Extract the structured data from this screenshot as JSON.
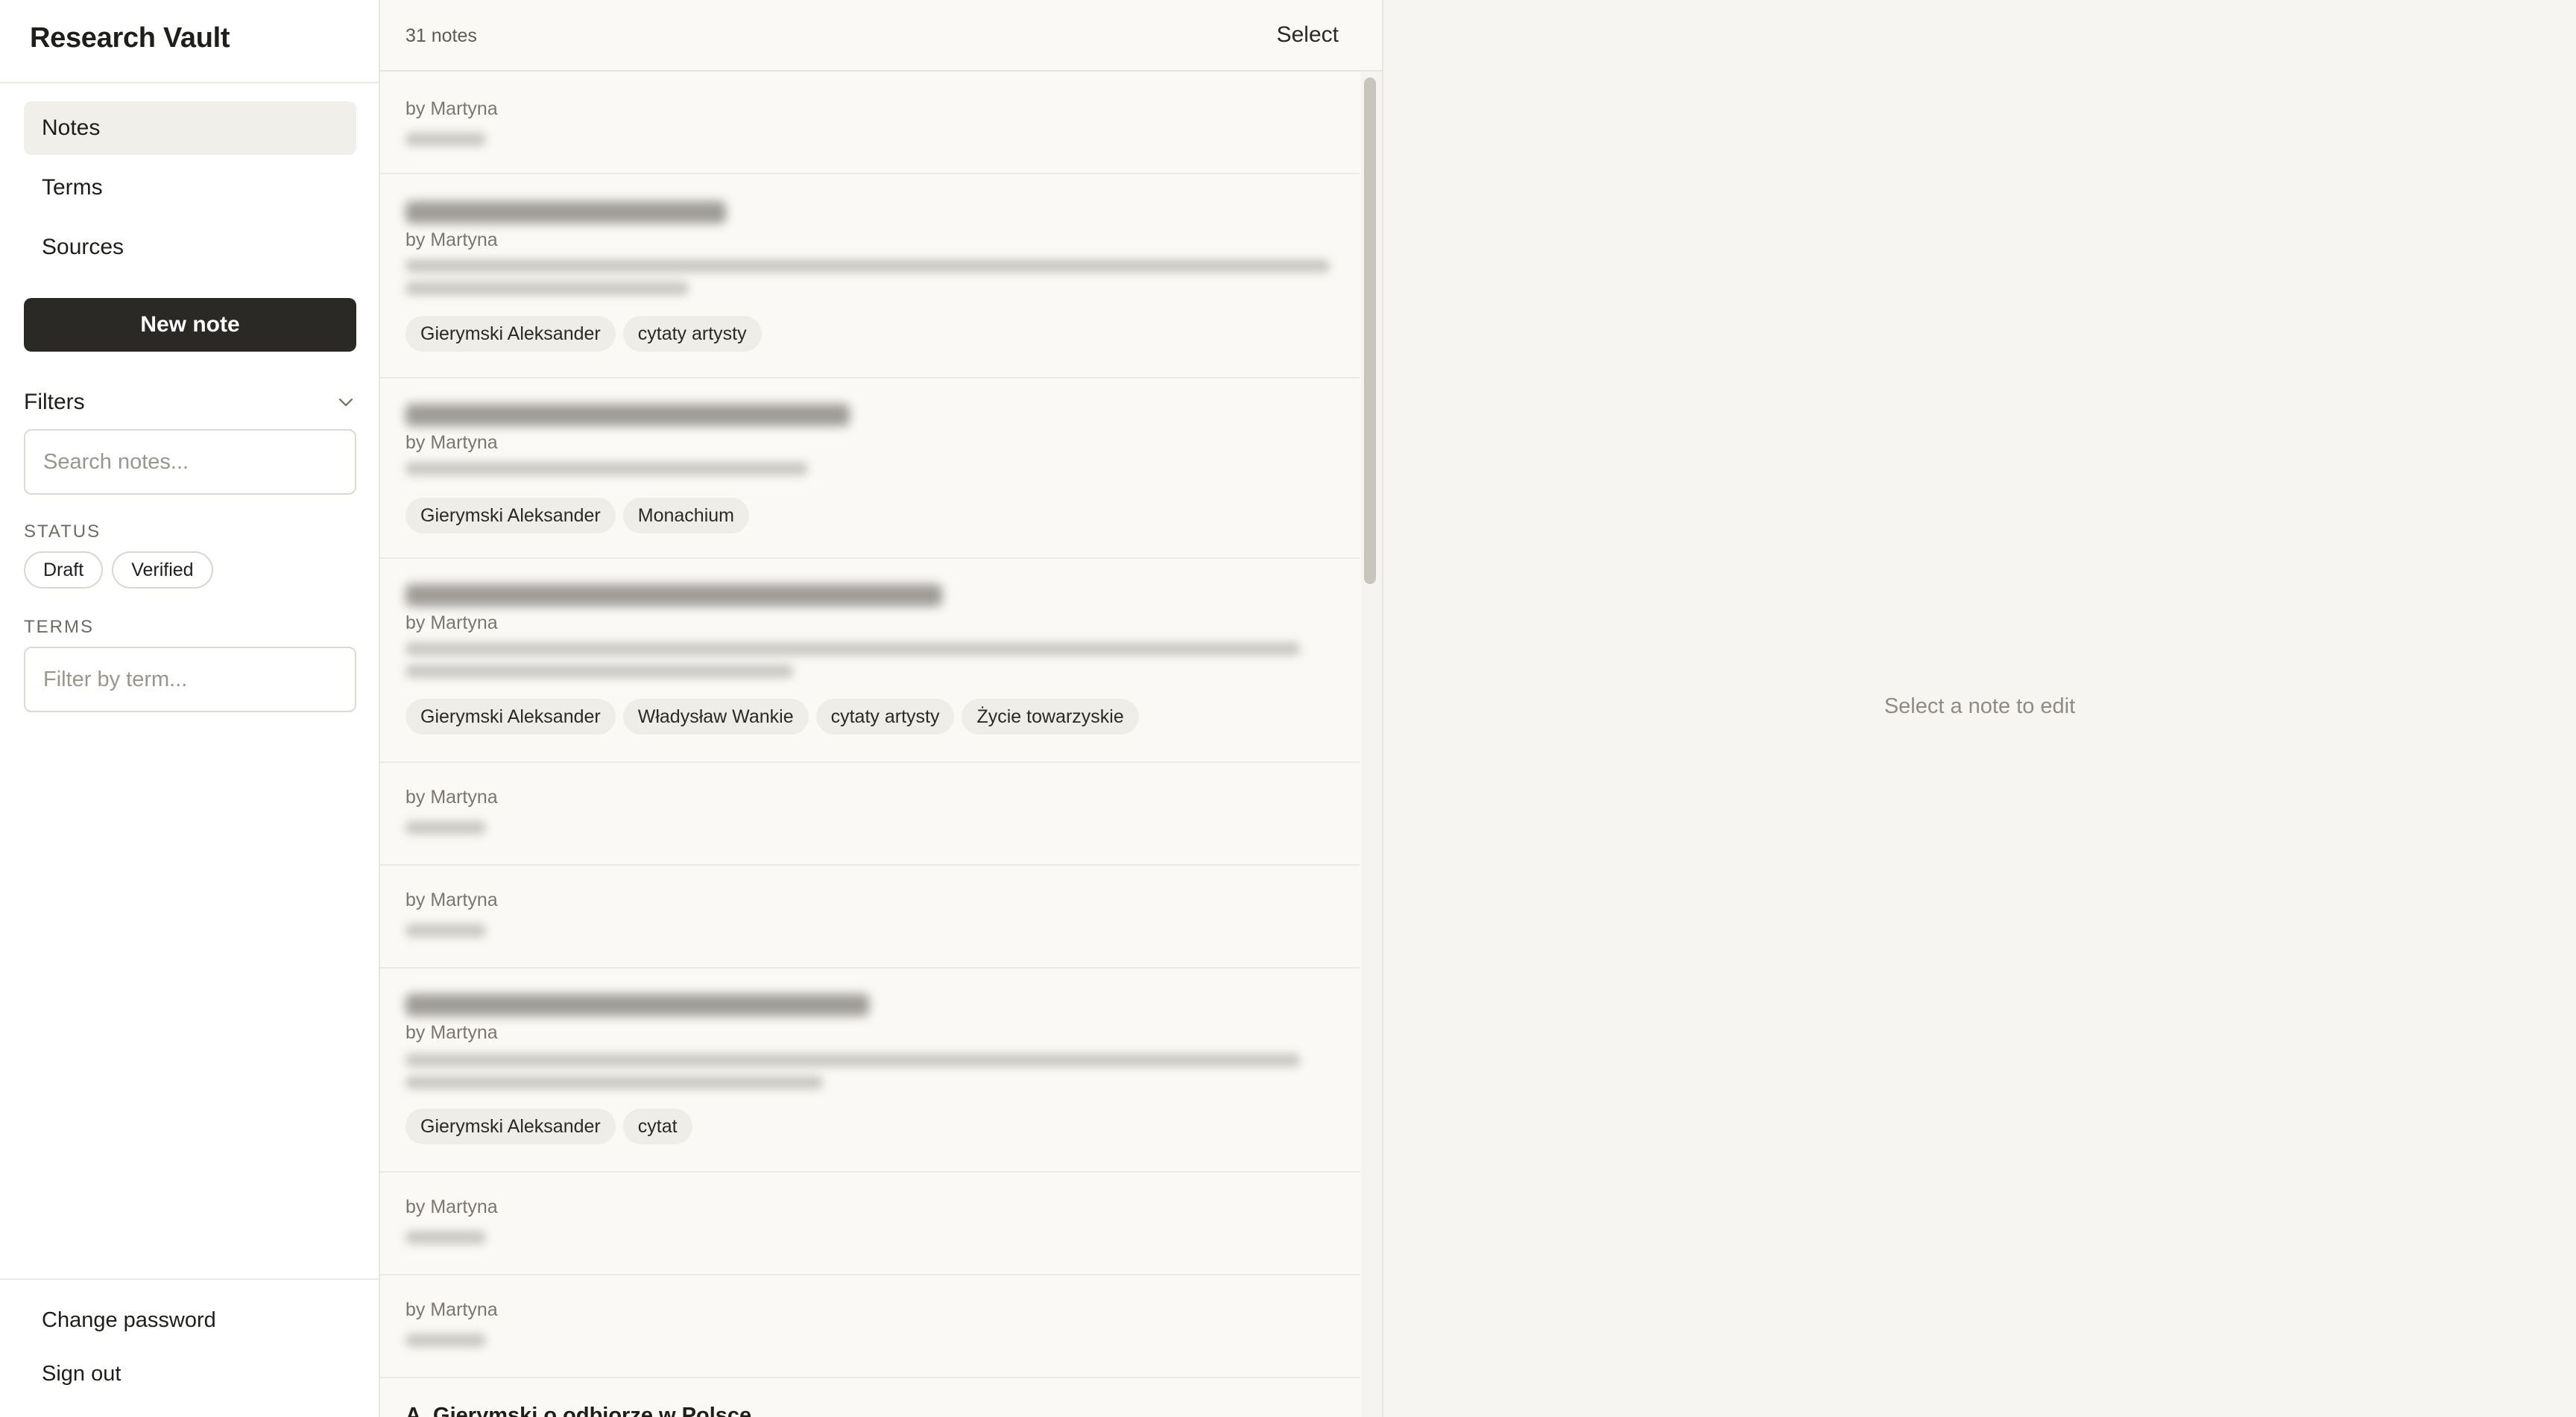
{
  "app": {
    "title": "Research Vault"
  },
  "sidebar": {
    "nav": [
      {
        "label": "Notes",
        "active": true
      },
      {
        "label": "Terms",
        "active": false
      },
      {
        "label": "Sources",
        "active": false
      }
    ],
    "new_note_label": "New note",
    "filters": {
      "label": "Filters",
      "search_placeholder": "Search notes...",
      "status_label": "STATUS",
      "status_options": [
        "Draft",
        "Verified"
      ],
      "terms_label": "TERMS",
      "terms_placeholder": "Filter by term..."
    },
    "footer": {
      "change_password": "Change password",
      "sign_out": "Sign out"
    }
  },
  "list": {
    "count_label": "31 notes",
    "select_label": "Select",
    "notes": [
      {
        "author": "by Martyna",
        "tags": []
      },
      {
        "author": "by Martyna",
        "tags": [
          "Gierymski Aleksander",
          "cytaty artysty"
        ]
      },
      {
        "author": "by Martyna",
        "tags": [
          "Gierymski Aleksander",
          "Monachium"
        ]
      },
      {
        "author": "by Martyna",
        "tags": [
          "Gierymski Aleksander",
          "Władysław Wankie",
          "cytaty artysty",
          "Życie towarzyskie"
        ]
      },
      {
        "author": "by Martyna",
        "tags": []
      },
      {
        "author": "by Martyna",
        "tags": []
      },
      {
        "author": "by Martyna",
        "tags": [
          "Gierymski Aleksander",
          "cytat"
        ]
      },
      {
        "author": "by Martyna",
        "tags": []
      },
      {
        "author": "by Martyna",
        "tags": []
      }
    ],
    "partial_title": "A. Gierymski o odbiorze w Polsce"
  },
  "editor": {
    "empty_message": "Select a note to edit"
  },
  "colors": {
    "primary_button": "#2a2925",
    "active_nav": "#f1efea",
    "tag_bg": "#efede8"
  }
}
